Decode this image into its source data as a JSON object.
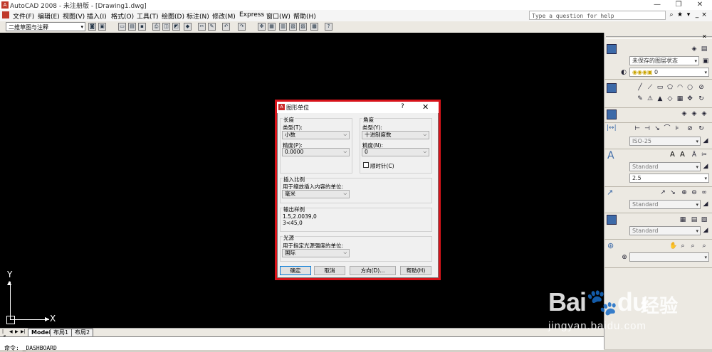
{
  "window": {
    "title": "AutoCAD 2008 - 未注册版 - [Drawing1.dwg]",
    "app_icon": "A",
    "controls": [
      "—",
      "❐",
      "✕"
    ]
  },
  "menu": {
    "items": [
      "文件(F)",
      "编辑(E)",
      "视图(V)",
      "插入(I)",
      "格式(O)",
      "工具(T)",
      "绘图(D)",
      "标注(N)",
      "修改(M)",
      "Express",
      "窗口(W)",
      "帮助(H)"
    ],
    "help_placeholder": "Type a question for help"
  },
  "toolbar": {
    "workspace": "二维草图与注释"
  },
  "ucs": {
    "x": "X",
    "y": "Y"
  },
  "layout_tabs": [
    "Model",
    "布局1",
    "布局2"
  ],
  "command_line": "命令: _DASHBOARD",
  "panel": {
    "layer_state": "未保存的图层状态",
    "layer_value": "0",
    "dim_style": "ISO-25",
    "text_style": "Standard",
    "text_height": "2.5",
    "mleader_style": "Standard",
    "table_style": "Standard"
  },
  "dialog": {
    "title": "图形单位",
    "help_glyph": "?",
    "close_glyph": "✕",
    "length": {
      "group": "长度",
      "type_label": "类型(T):",
      "type_value": "小数",
      "precision_label": "精度(P):",
      "precision_value": "0.0000"
    },
    "angle": {
      "group": "角度",
      "type_label": "类型(Y):",
      "type_value": "十进制度数",
      "precision_label": "精度(N):",
      "precision_value": "0",
      "clockwise_label": "顺时针(C)",
      "clockwise_checked": false
    },
    "insert_scale": {
      "group": "插入比例",
      "label": "用于缩放插入内容的单位:",
      "value": "毫米"
    },
    "sample": {
      "group": "输出样例",
      "line1": "1.5,2.0039,0",
      "line2": "3<45,0"
    },
    "lighting": {
      "group": "光源",
      "label": "用于指定光源强度的单位:",
      "value": "国际"
    },
    "buttons": {
      "ok": "确定",
      "cancel": "取消",
      "direction": "方向(D)...",
      "help": "帮助(H)"
    }
  },
  "watermark": {
    "brand": "Bai",
    "brand2": "du",
    "cn": "经验",
    "url": "jingyan.baidu.com"
  },
  "colors": {
    "highlight_frame": "#d8131a",
    "canvas": "#000000"
  }
}
